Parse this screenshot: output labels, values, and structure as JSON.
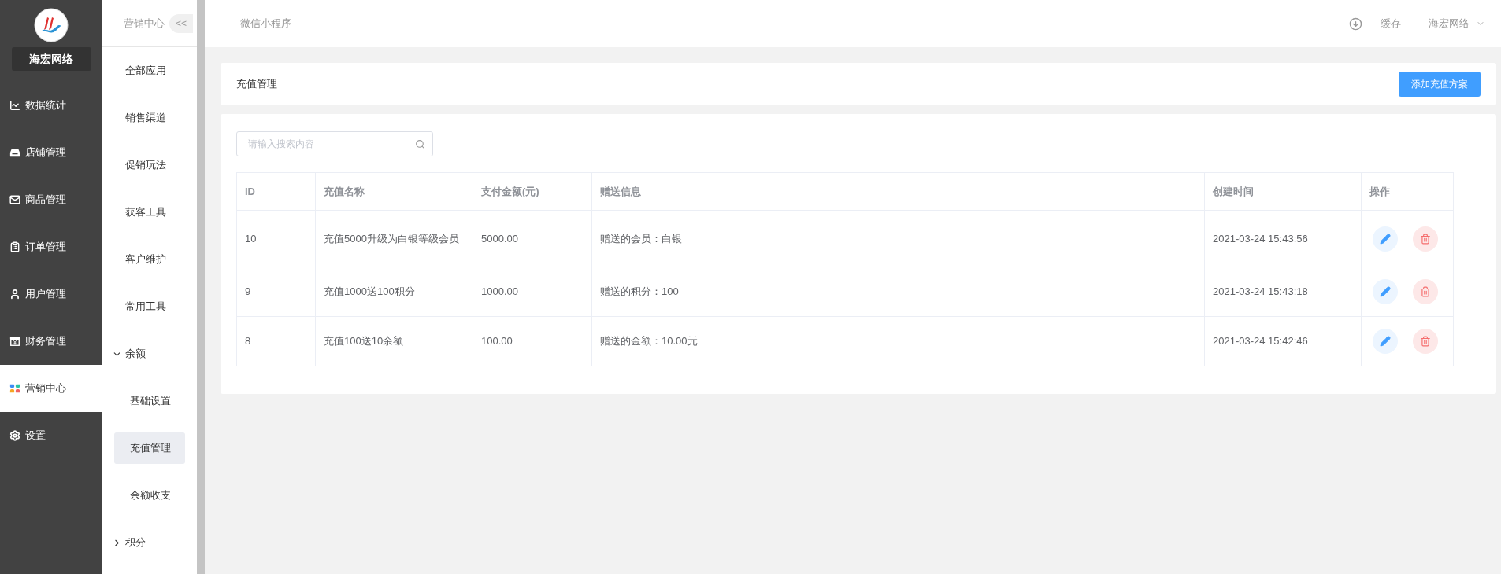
{
  "brand": {
    "name": "海宏网络"
  },
  "sidebar": {
    "items": [
      {
        "label": "数据统计",
        "selected": false
      },
      {
        "label": "店铺管理",
        "selected": false
      },
      {
        "label": "商品管理",
        "selected": false
      },
      {
        "label": "订单管理",
        "selected": false
      },
      {
        "label": "用户管理",
        "selected": false
      },
      {
        "label": "财务管理",
        "selected": false
      },
      {
        "label": "营销中心",
        "selected": true
      },
      {
        "label": "设置",
        "selected": false
      }
    ]
  },
  "submenu": {
    "title": "营销中心",
    "collapse": "<<",
    "items": [
      {
        "kind": "link",
        "label": "全部应用",
        "selected": false
      },
      {
        "kind": "link",
        "label": "销售渠道",
        "selected": false
      },
      {
        "kind": "link",
        "label": "促销玩法",
        "selected": false
      },
      {
        "kind": "link",
        "label": "获客工具",
        "selected": false
      },
      {
        "kind": "link",
        "label": "客户维护",
        "selected": false
      },
      {
        "kind": "link",
        "label": "常用工具",
        "selected": false
      },
      {
        "kind": "group",
        "label": "余额",
        "expanded": true,
        "children": [
          {
            "label": "基础设置",
            "selected": false
          },
          {
            "label": "充值管理",
            "selected": true
          },
          {
            "label": "余额收支",
            "selected": false
          }
        ]
      },
      {
        "kind": "group",
        "label": "积分",
        "expanded": false
      }
    ]
  },
  "topbar": {
    "title": "微信小程序",
    "cache": "缓存",
    "user": "海宏网络"
  },
  "page": {
    "title": "充值管理",
    "add_button": "添加充值方案"
  },
  "search": {
    "placeholder": "请输入搜索内容"
  },
  "table": {
    "columns": [
      "ID",
      "充值名称",
      "支付金额(元)",
      "赠送信息",
      "创建时间",
      "操作"
    ],
    "rows": [
      {
        "id": "10",
        "name": "充值5000升级为白银等级会员",
        "amount": "5000.00",
        "gift": "赠送的会员：白银",
        "created": "2021-03-24 15:43:56"
      },
      {
        "id": "9",
        "name": "充值1000送100积分",
        "amount": "1000.00",
        "gift": "赠送的积分：100",
        "created": "2021-03-24 15:43:18"
      },
      {
        "id": "8",
        "name": "充值100送10余额",
        "amount": "100.00",
        "gift": "赠送的金额：10.00元",
        "created": "2021-03-24 15:42:46"
      }
    ]
  }
}
